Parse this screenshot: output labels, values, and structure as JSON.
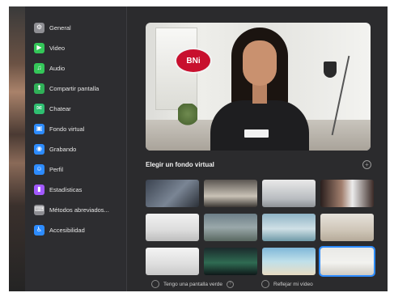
{
  "sidebar": {
    "items": [
      {
        "label": "General",
        "icon": "gear-icon",
        "color": "#8e8e93",
        "glyph": "⚙"
      },
      {
        "label": "Video",
        "icon": "video-icon",
        "color": "#34c759",
        "glyph": "▶"
      },
      {
        "label": "Audio",
        "icon": "headphones-icon",
        "color": "#34c759",
        "glyph": "♫"
      },
      {
        "label": "Compartir pantalla",
        "icon": "share-screen-icon",
        "color": "#30b158",
        "glyph": "⬆"
      },
      {
        "label": "Chatear",
        "icon": "chat-icon",
        "color": "#2fbf71",
        "glyph": "✉"
      },
      {
        "label": "Fondo virtual",
        "icon": "virtual-background-icon",
        "color": "#2d8cff",
        "glyph": "▣"
      },
      {
        "label": "Grabando",
        "icon": "record-icon",
        "color": "#2d8cff",
        "glyph": "◉"
      },
      {
        "label": "Perfil",
        "icon": "profile-icon",
        "color": "#2d8cff",
        "glyph": "☺"
      },
      {
        "label": "Estadísticas",
        "icon": "statistics-icon",
        "color": "#a259ff",
        "glyph": "▮"
      },
      {
        "label": "Métodos abreviados...",
        "icon": "keyboard-icon",
        "color": "#8e8e93",
        "glyph": "⌨"
      },
      {
        "label": "Accesibilidad",
        "icon": "accessibility-icon",
        "color": "#2d8cff",
        "glyph": "♿"
      }
    ]
  },
  "preview": {
    "logo_text": "BNi"
  },
  "virtual_background": {
    "title": "Elegir un fondo virtual",
    "add_icon": "plus-circle-icon",
    "selected_index": 11
  },
  "footer": {
    "green_screen_label": "Tengo una pantalla verde",
    "mirror_label": "Reflejar mi vídeo"
  }
}
